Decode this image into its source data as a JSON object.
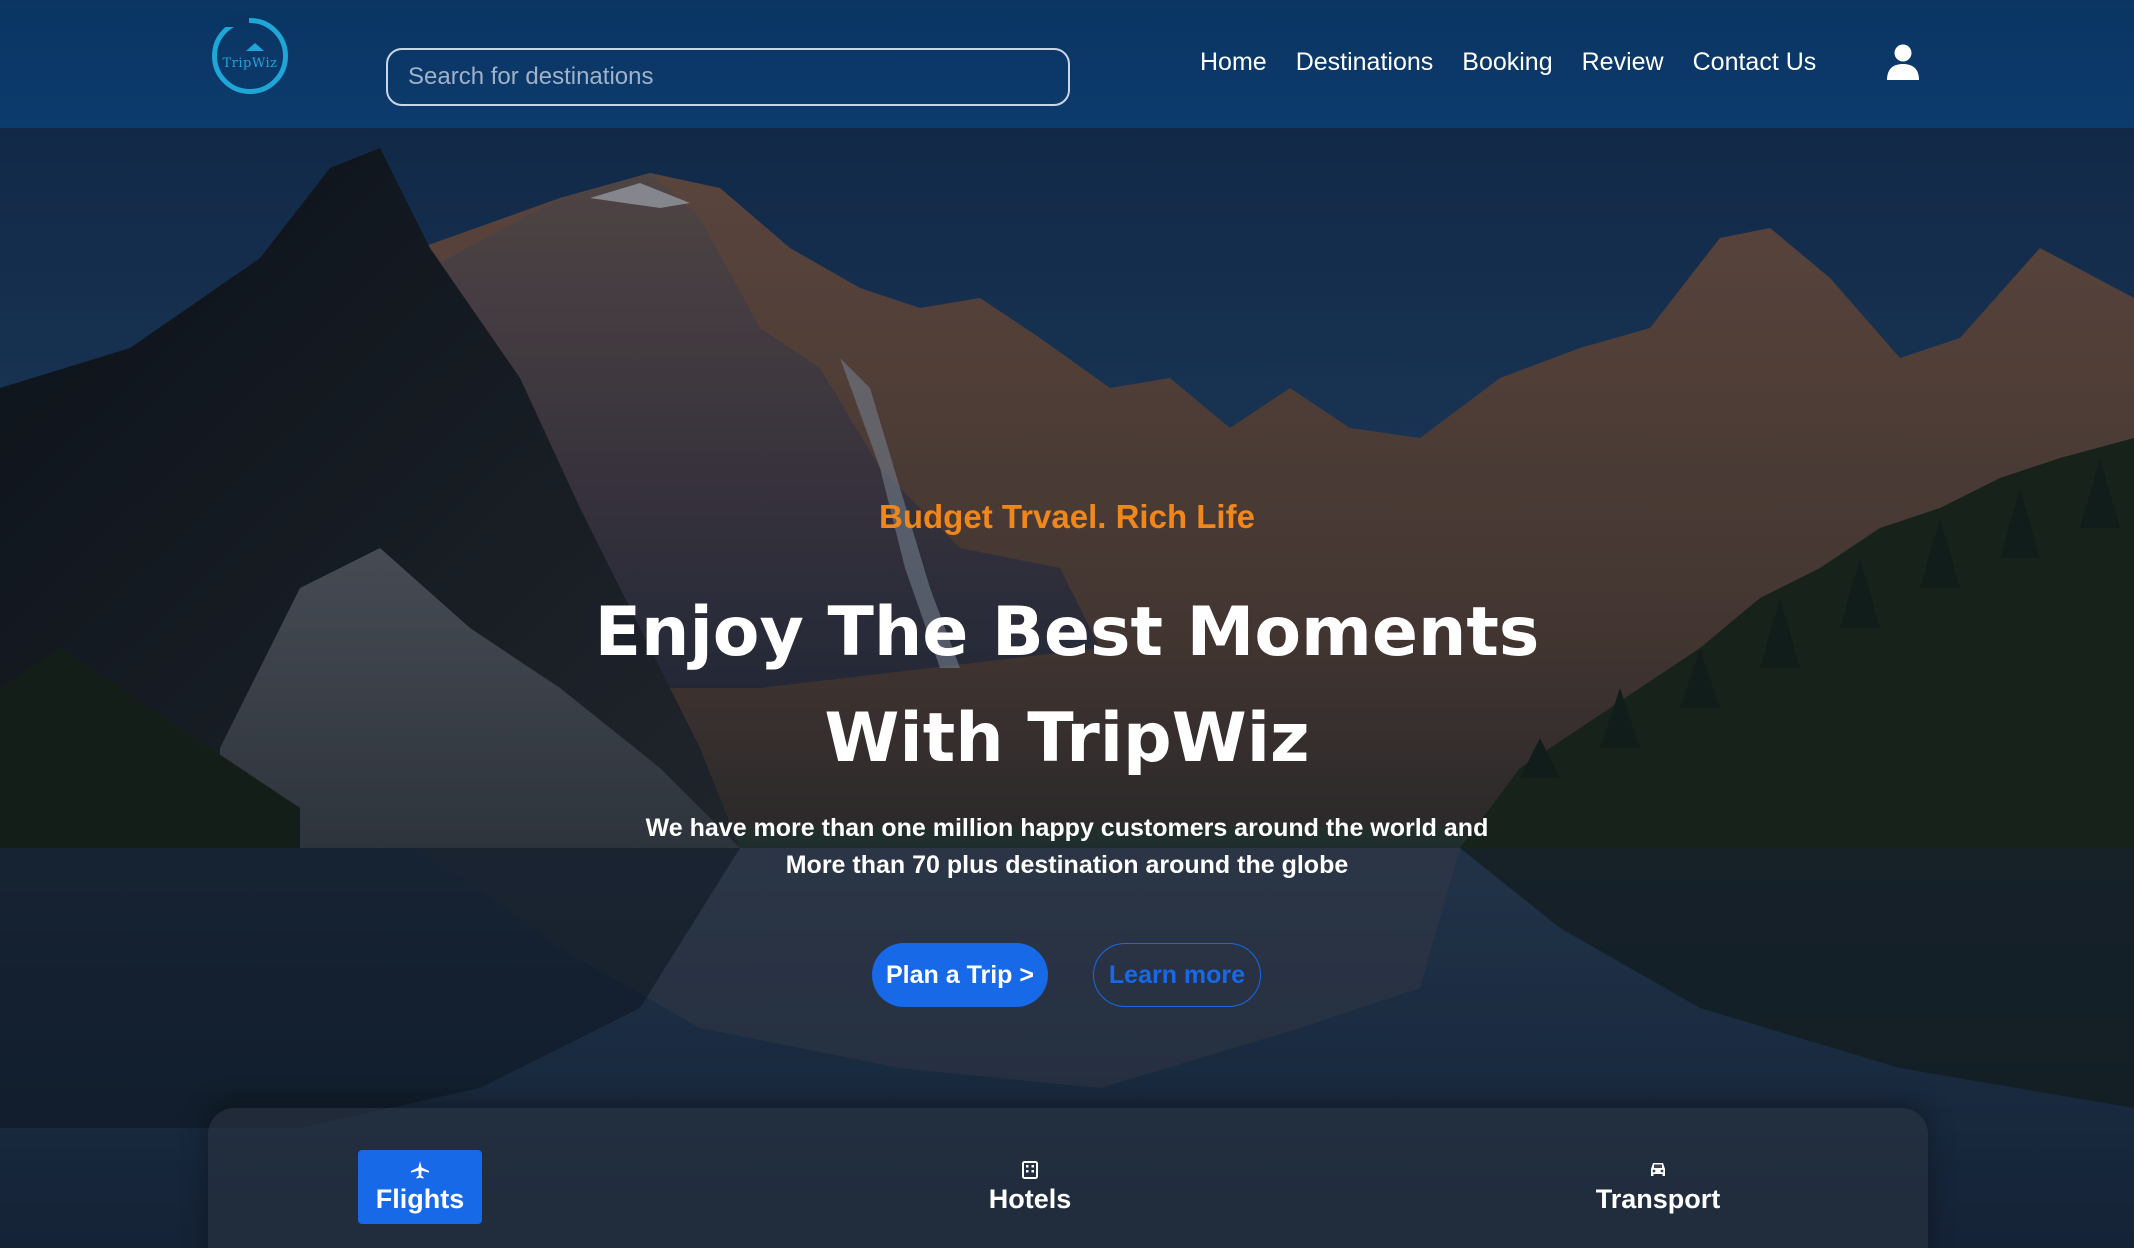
{
  "brand": {
    "logo_text": "TripWiz",
    "accent_color": "#1ea6d6"
  },
  "nav": {
    "search_placeholder": "Search for destinations",
    "links": [
      "Home",
      "Destinations",
      "Booking",
      "Review",
      "Contact Us"
    ],
    "user_icon": "user-icon",
    "background_color": "#0a3563"
  },
  "hero": {
    "tagline": "Budget Trvael. Rich Life",
    "headline_line1": "Enjoy The Best Moments",
    "headline_line2": "With TripWiz",
    "subtext_line1": "We have more than one million happy customers around the world and",
    "subtext_line2": "More than 70 plus destination around the globe",
    "primary_button": "Plan a Trip >",
    "secondary_button": "Learn more",
    "tagline_color": "#f0871a",
    "button_color": "#1769e8"
  },
  "booking": {
    "tabs": [
      {
        "label": "Flights",
        "icon": "plane-icon",
        "active": true
      },
      {
        "label": "Hotels",
        "icon": "building-icon",
        "active": false
      },
      {
        "label": "Transport",
        "icon": "car-icon",
        "active": false
      }
    ]
  }
}
